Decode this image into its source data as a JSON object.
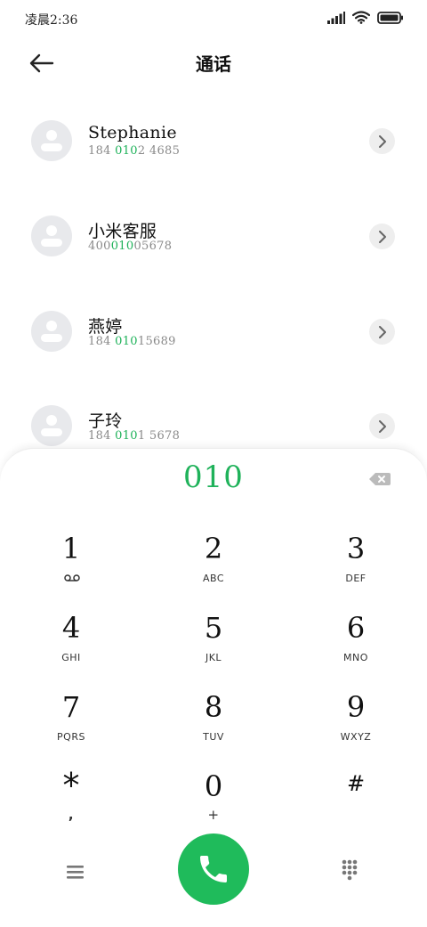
{
  "status": {
    "time": "凌晨2:36"
  },
  "header": {
    "title": "通话"
  },
  "contacts": [
    {
      "name": "Stephanie",
      "number_parts": [
        "184 ",
        "010",
        "2 4685"
      ]
    },
    {
      "name": "小米客服",
      "number_parts": [
        "400",
        "010",
        "05678"
      ]
    },
    {
      "name": "燕婷",
      "number_parts": [
        "184 ",
        "010",
        "15689"
      ]
    },
    {
      "name": "子玲",
      "number_parts": [
        "184 ",
        "010",
        "1 5678"
      ]
    }
  ],
  "dialer": {
    "input": "010",
    "keys": [
      {
        "digit": "1",
        "letters": ""
      },
      {
        "digit": "2",
        "letters": "ABC"
      },
      {
        "digit": "3",
        "letters": "DEF"
      },
      {
        "digit": "4",
        "letters": "GHI"
      },
      {
        "digit": "5",
        "letters": "JKL"
      },
      {
        "digit": "6",
        "letters": "MNO"
      },
      {
        "digit": "7",
        "letters": "PQRS"
      },
      {
        "digit": "8",
        "letters": "TUV"
      },
      {
        "digit": "9",
        "letters": "WXYZ"
      },
      {
        "digit": "*",
        "letters": ","
      },
      {
        "digit": "0",
        "letters": "+"
      },
      {
        "digit": "#",
        "letters": ""
      }
    ]
  },
  "icons": {
    "signal": "signal-icon",
    "wifi": "wifi-icon",
    "battery": "battery-icon",
    "back": "back-arrow-icon",
    "chevron": "chevron-right-icon",
    "backspace": "backspace-icon",
    "voicemail": "voicemail-icon",
    "menu": "menu-icon",
    "call": "phone-icon",
    "keypad": "keypad-icon"
  },
  "colors": {
    "accent": "#1fb25a",
    "call_button": "#1fbb5b"
  }
}
